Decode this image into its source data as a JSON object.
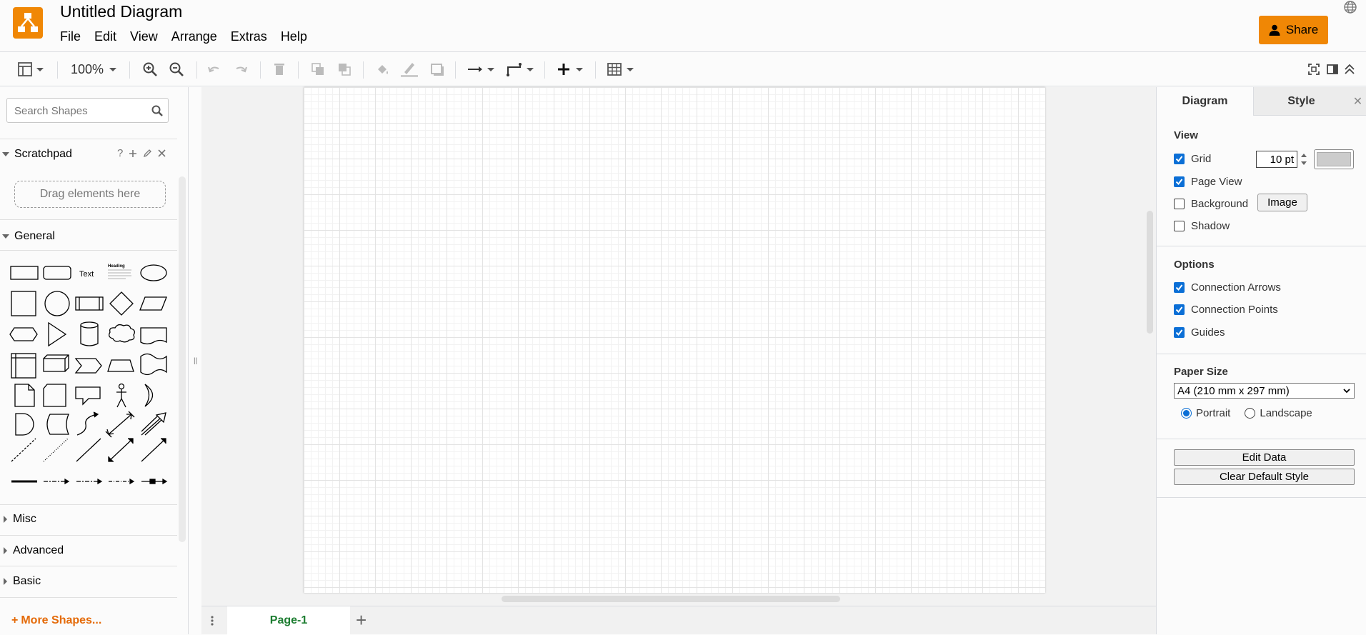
{
  "app": {
    "title": "Untitled Diagram",
    "accent_color": "#f08705",
    "logo_icon": "drawio-logo-icon"
  },
  "menu": [
    "File",
    "Edit",
    "View",
    "Arrange",
    "Extras",
    "Help"
  ],
  "header": {
    "share_label": "Share",
    "share_icon": "user-icon",
    "language_icon": "globe-icon"
  },
  "toolbar": {
    "zoom": "100%",
    "items": [
      "format-view-icon",
      "zoom-in-icon",
      "zoom-out-icon",
      "undo-icon",
      "redo-icon",
      "delete-icon",
      "to-front-icon",
      "to-back-icon",
      "fill-color-icon",
      "line-color-icon",
      "shadow-icon",
      "connection-icon",
      "waypoints-icon",
      "insert-icon",
      "table-icon",
      "fullscreen-icon",
      "toggle-format-panel-icon",
      "collapse-icon"
    ]
  },
  "sidebar": {
    "search_placeholder": "Search Shapes",
    "scratchpad": {
      "title": "Scratchpad",
      "help": "?",
      "drop_hint": "Drag elements here"
    },
    "general": {
      "title": "General",
      "text_shape_label": "Text",
      "heading_shape_label": "Heading"
    },
    "collapsed_sections": [
      "Misc",
      "Advanced",
      "Basic"
    ],
    "more_shapes": "More Shapes..."
  },
  "pages": {
    "tabs": [
      "Page-1"
    ],
    "active_color": "#1d7d31"
  },
  "format_panel": {
    "tabs": [
      "Diagram",
      "Style"
    ],
    "view_heading": "View",
    "grid": {
      "label": "Grid",
      "checked": true,
      "size": "10 pt",
      "color": "#cccccc"
    },
    "page_view": {
      "label": "Page View",
      "checked": true
    },
    "background": {
      "label": "Background",
      "checked": false,
      "button": "Image"
    },
    "shadow": {
      "label": "Shadow",
      "checked": false
    },
    "options_heading": "Options",
    "connection_arrows": {
      "label": "Connection Arrows",
      "checked": true
    },
    "connection_points": {
      "label": "Connection Points",
      "checked": true
    },
    "guides": {
      "label": "Guides",
      "checked": true
    },
    "paper_heading": "Paper Size",
    "paper_size": "A4 (210 mm x 297 mm)",
    "orientation": {
      "portrait": "Portrait",
      "landscape": "Landscape",
      "selected": "Portrait"
    },
    "edit_data": "Edit Data",
    "clear_style": "Clear Default Style"
  }
}
